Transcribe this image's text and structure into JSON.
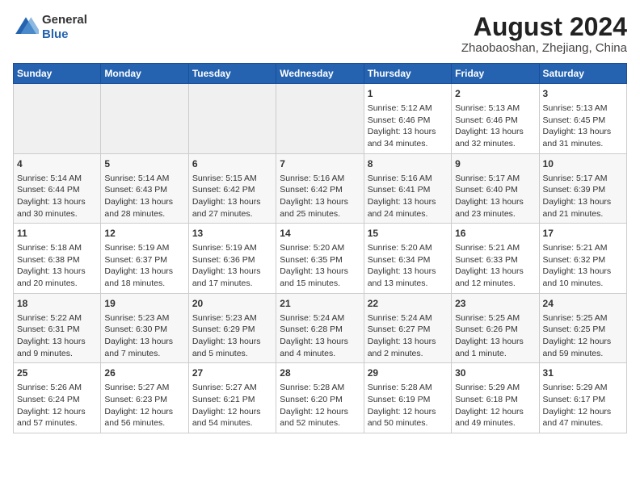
{
  "header": {
    "logo_line1": "General",
    "logo_line2": "Blue",
    "main_title": "August 2024",
    "subtitle": "Zhaobaoshan, Zhejiang, China"
  },
  "days_of_week": [
    "Sunday",
    "Monday",
    "Tuesday",
    "Wednesday",
    "Thursday",
    "Friday",
    "Saturday"
  ],
  "weeks": [
    [
      {
        "day": "",
        "empty": true
      },
      {
        "day": "",
        "empty": true
      },
      {
        "day": "",
        "empty": true
      },
      {
        "day": "",
        "empty": true
      },
      {
        "day": "1",
        "line1": "Sunrise: 5:12 AM",
        "line2": "Sunset: 6:46 PM",
        "line3": "Daylight: 13 hours",
        "line4": "and 34 minutes."
      },
      {
        "day": "2",
        "line1": "Sunrise: 5:13 AM",
        "line2": "Sunset: 6:46 PM",
        "line3": "Daylight: 13 hours",
        "line4": "and 32 minutes."
      },
      {
        "day": "3",
        "line1": "Sunrise: 5:13 AM",
        "line2": "Sunset: 6:45 PM",
        "line3": "Daylight: 13 hours",
        "line4": "and 31 minutes."
      }
    ],
    [
      {
        "day": "4",
        "line1": "Sunrise: 5:14 AM",
        "line2": "Sunset: 6:44 PM",
        "line3": "Daylight: 13 hours",
        "line4": "and 30 minutes."
      },
      {
        "day": "5",
        "line1": "Sunrise: 5:14 AM",
        "line2": "Sunset: 6:43 PM",
        "line3": "Daylight: 13 hours",
        "line4": "and 28 minutes."
      },
      {
        "day": "6",
        "line1": "Sunrise: 5:15 AM",
        "line2": "Sunset: 6:42 PM",
        "line3": "Daylight: 13 hours",
        "line4": "and 27 minutes."
      },
      {
        "day": "7",
        "line1": "Sunrise: 5:16 AM",
        "line2": "Sunset: 6:42 PM",
        "line3": "Daylight: 13 hours",
        "line4": "and 25 minutes."
      },
      {
        "day": "8",
        "line1": "Sunrise: 5:16 AM",
        "line2": "Sunset: 6:41 PM",
        "line3": "Daylight: 13 hours",
        "line4": "and 24 minutes."
      },
      {
        "day": "9",
        "line1": "Sunrise: 5:17 AM",
        "line2": "Sunset: 6:40 PM",
        "line3": "Daylight: 13 hours",
        "line4": "and 23 minutes."
      },
      {
        "day": "10",
        "line1": "Sunrise: 5:17 AM",
        "line2": "Sunset: 6:39 PM",
        "line3": "Daylight: 13 hours",
        "line4": "and 21 minutes."
      }
    ],
    [
      {
        "day": "11",
        "line1": "Sunrise: 5:18 AM",
        "line2": "Sunset: 6:38 PM",
        "line3": "Daylight: 13 hours",
        "line4": "and 20 minutes."
      },
      {
        "day": "12",
        "line1": "Sunrise: 5:19 AM",
        "line2": "Sunset: 6:37 PM",
        "line3": "Daylight: 13 hours",
        "line4": "and 18 minutes."
      },
      {
        "day": "13",
        "line1": "Sunrise: 5:19 AM",
        "line2": "Sunset: 6:36 PM",
        "line3": "Daylight: 13 hours",
        "line4": "and 17 minutes."
      },
      {
        "day": "14",
        "line1": "Sunrise: 5:20 AM",
        "line2": "Sunset: 6:35 PM",
        "line3": "Daylight: 13 hours",
        "line4": "and 15 minutes."
      },
      {
        "day": "15",
        "line1": "Sunrise: 5:20 AM",
        "line2": "Sunset: 6:34 PM",
        "line3": "Daylight: 13 hours",
        "line4": "and 13 minutes."
      },
      {
        "day": "16",
        "line1": "Sunrise: 5:21 AM",
        "line2": "Sunset: 6:33 PM",
        "line3": "Daylight: 13 hours",
        "line4": "and 12 minutes."
      },
      {
        "day": "17",
        "line1": "Sunrise: 5:21 AM",
        "line2": "Sunset: 6:32 PM",
        "line3": "Daylight: 13 hours",
        "line4": "and 10 minutes."
      }
    ],
    [
      {
        "day": "18",
        "line1": "Sunrise: 5:22 AM",
        "line2": "Sunset: 6:31 PM",
        "line3": "Daylight: 13 hours",
        "line4": "and 9 minutes."
      },
      {
        "day": "19",
        "line1": "Sunrise: 5:23 AM",
        "line2": "Sunset: 6:30 PM",
        "line3": "Daylight: 13 hours",
        "line4": "and 7 minutes."
      },
      {
        "day": "20",
        "line1": "Sunrise: 5:23 AM",
        "line2": "Sunset: 6:29 PM",
        "line3": "Daylight: 13 hours",
        "line4": "and 5 minutes."
      },
      {
        "day": "21",
        "line1": "Sunrise: 5:24 AM",
        "line2": "Sunset: 6:28 PM",
        "line3": "Daylight: 13 hours",
        "line4": "and 4 minutes."
      },
      {
        "day": "22",
        "line1": "Sunrise: 5:24 AM",
        "line2": "Sunset: 6:27 PM",
        "line3": "Daylight: 13 hours",
        "line4": "and 2 minutes."
      },
      {
        "day": "23",
        "line1": "Sunrise: 5:25 AM",
        "line2": "Sunset: 6:26 PM",
        "line3": "Daylight: 13 hours",
        "line4": "and 1 minute."
      },
      {
        "day": "24",
        "line1": "Sunrise: 5:25 AM",
        "line2": "Sunset: 6:25 PM",
        "line3": "Daylight: 12 hours",
        "line4": "and 59 minutes."
      }
    ],
    [
      {
        "day": "25",
        "line1": "Sunrise: 5:26 AM",
        "line2": "Sunset: 6:24 PM",
        "line3": "Daylight: 12 hours",
        "line4": "and 57 minutes."
      },
      {
        "day": "26",
        "line1": "Sunrise: 5:27 AM",
        "line2": "Sunset: 6:23 PM",
        "line3": "Daylight: 12 hours",
        "line4": "and 56 minutes."
      },
      {
        "day": "27",
        "line1": "Sunrise: 5:27 AM",
        "line2": "Sunset: 6:21 PM",
        "line3": "Daylight: 12 hours",
        "line4": "and 54 minutes."
      },
      {
        "day": "28",
        "line1": "Sunrise: 5:28 AM",
        "line2": "Sunset: 6:20 PM",
        "line3": "Daylight: 12 hours",
        "line4": "and 52 minutes."
      },
      {
        "day": "29",
        "line1": "Sunrise: 5:28 AM",
        "line2": "Sunset: 6:19 PM",
        "line3": "Daylight: 12 hours",
        "line4": "and 50 minutes."
      },
      {
        "day": "30",
        "line1": "Sunrise: 5:29 AM",
        "line2": "Sunset: 6:18 PM",
        "line3": "Daylight: 12 hours",
        "line4": "and 49 minutes."
      },
      {
        "day": "31",
        "line1": "Sunrise: 5:29 AM",
        "line2": "Sunset: 6:17 PM",
        "line3": "Daylight: 12 hours",
        "line4": "and 47 minutes."
      }
    ]
  ],
  "colors": {
    "header_bg": "#2563b0",
    "header_text": "#ffffff",
    "border": "#cccccc",
    "empty_bg": "#f0f0f0"
  }
}
